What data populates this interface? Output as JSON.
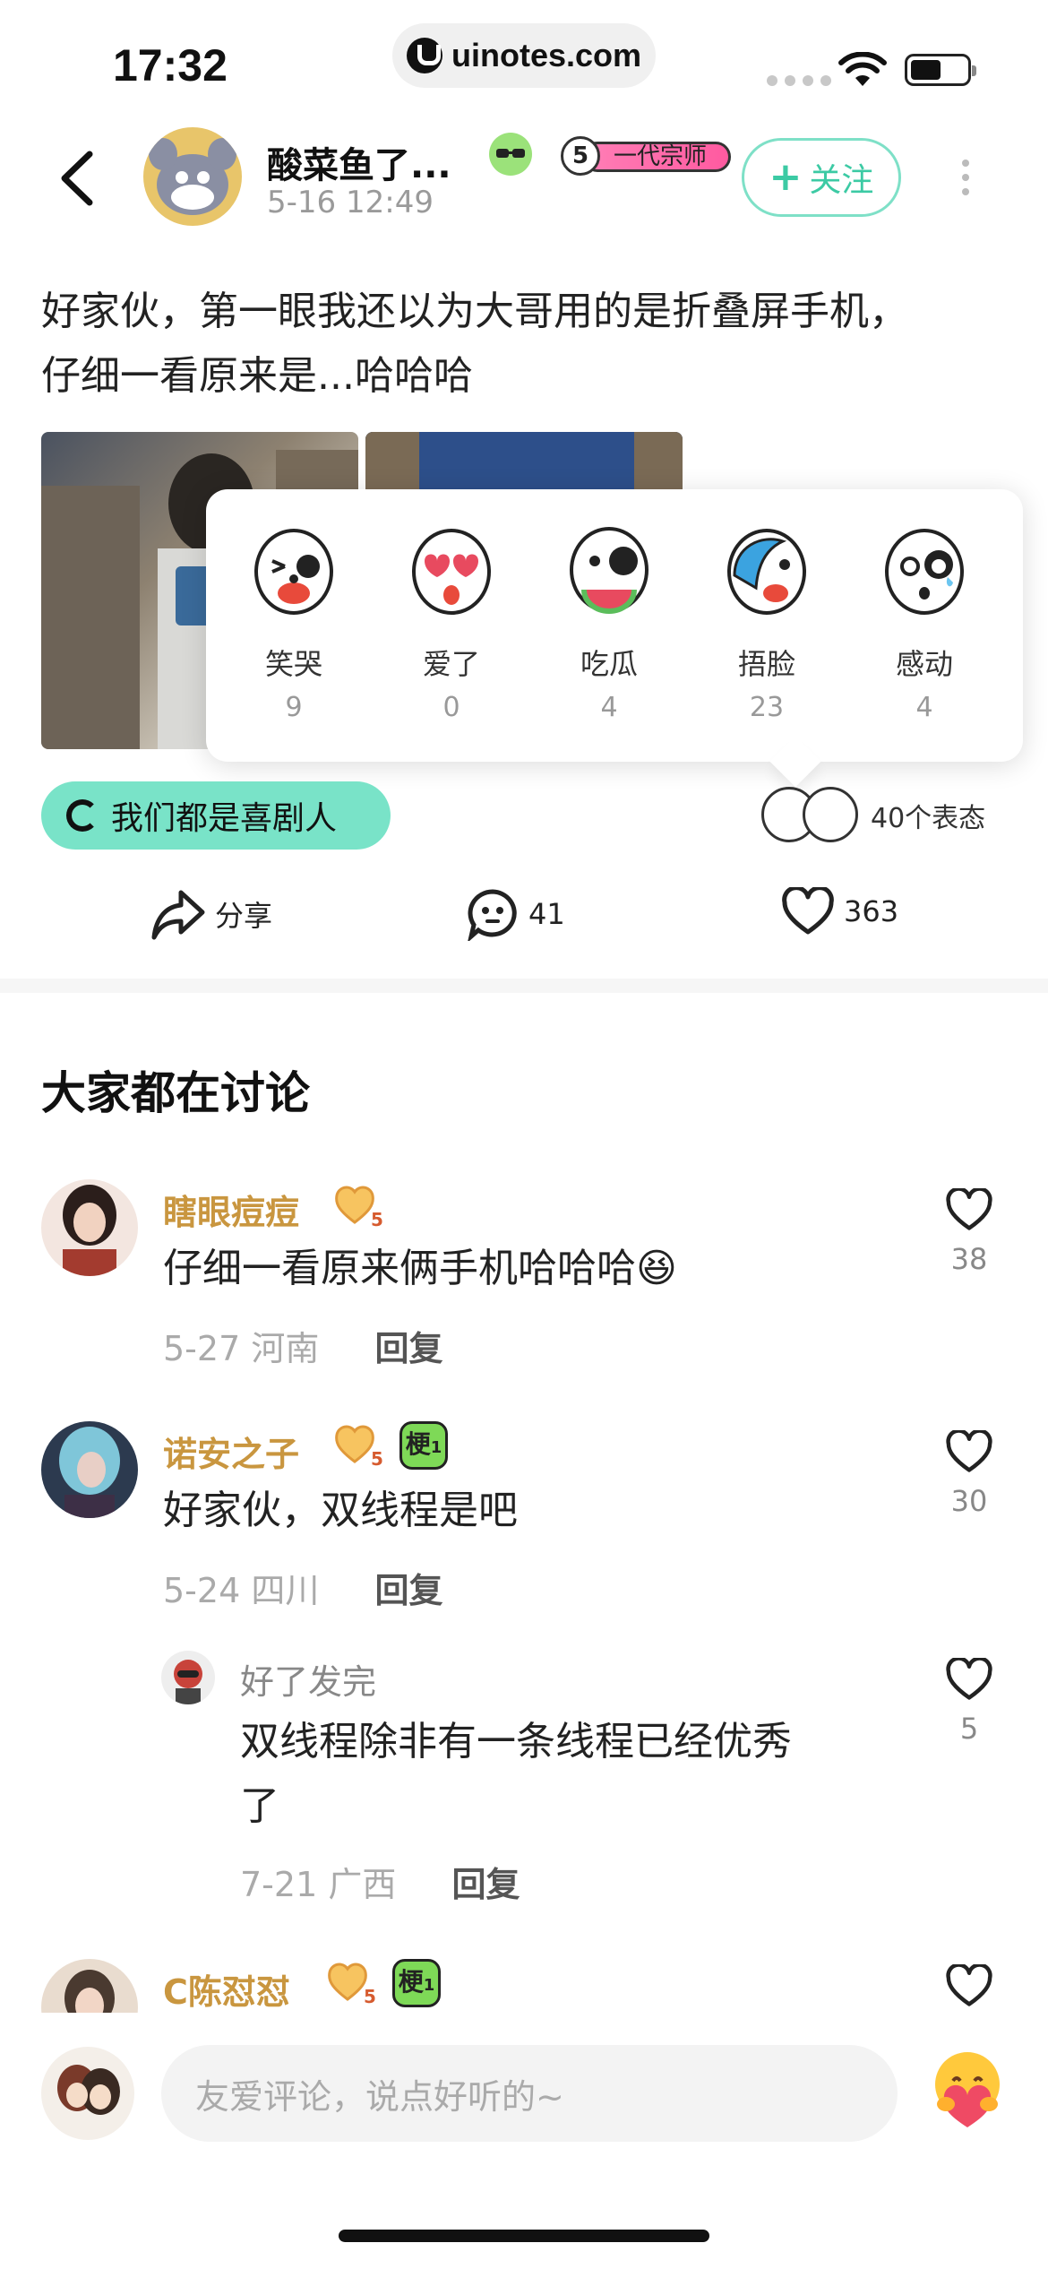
{
  "status_bar": {
    "time": "17:32",
    "url": "uinotes.com"
  },
  "post": {
    "author": "酸菜鱼了...",
    "time": "5-16 12:49",
    "level": "5",
    "title_badge": "一代宗师",
    "follow_label": "关注",
    "text_line1": "好家伙，第一眼我还以为大哥用的是折叠屏手机，",
    "text_line2": "仔细一看原来是...哈哈哈"
  },
  "reactions": [
    {
      "label": "笑哭",
      "count": "9"
    },
    {
      "label": "爱了",
      "count": "0"
    },
    {
      "label": "吃瓜",
      "count": "4"
    },
    {
      "label": "捂脸",
      "count": "23"
    },
    {
      "label": "感动",
      "count": "4"
    }
  ],
  "topic": "我们都是喜剧人",
  "reaction_summary": "40个表态",
  "actions": {
    "share": "分享",
    "comments": "41",
    "likes": "363"
  },
  "section_title": "大家都在讨论",
  "comments": [
    {
      "name": "瞎眼痘痘",
      "level": "5",
      "text": "仔细一看原来俩手机哈哈哈😆",
      "date": "5-27",
      "location": "河南",
      "reply": "回复",
      "likes": "38"
    },
    {
      "name": "诺安之子",
      "level": "5",
      "geng": "梗",
      "geng_level": "1",
      "text": "好家伙，双线程是吧",
      "date": "5-24",
      "location": "四川",
      "reply": "回复",
      "likes": "30",
      "sub": {
        "name": "好了发完",
        "text_line1": "双线程除非有一条线程已经优秀",
        "text_line2": "了",
        "date": "7-21",
        "location": "广西",
        "reply": "回复",
        "likes": "5"
      }
    },
    {
      "name": "C陈怼怼",
      "level": "5",
      "geng": "梗",
      "geng_level": "1"
    }
  ],
  "input": {
    "placeholder": "友爱评论，说点好听的~"
  },
  "colors": {
    "accent": "#3ccaa4",
    "topic_bg": "#79e3c8",
    "username": "#c9963f"
  }
}
